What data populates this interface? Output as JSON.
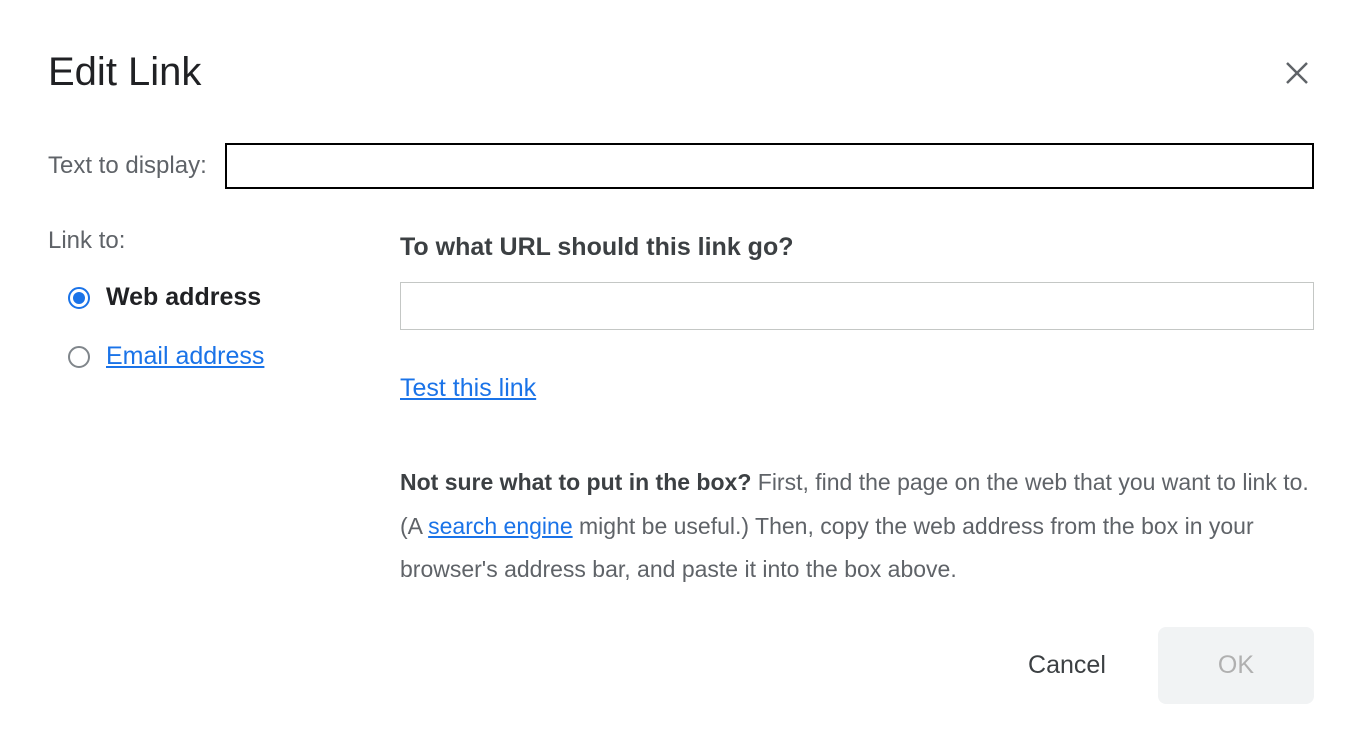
{
  "dialog": {
    "title": "Edit Link",
    "text_to_display_label": "Text to display:",
    "text_to_display_value": "",
    "link_to_label": "Link to:",
    "options": {
      "web_address": "Web address",
      "email_address": "Email address"
    },
    "url_section": {
      "question": "To what URL should this link go?",
      "value": "",
      "test_link": "Test this link",
      "help_bold": "Not sure what to put in the box?",
      "help_part1": " First, find the page on the web that you want to link to. (A ",
      "help_link": "search engine",
      "help_part2": " might be useful.) Then, copy the web address from the box in your browser's address bar, and paste it into the box above."
    },
    "footer": {
      "cancel": "Cancel",
      "ok": "OK"
    }
  }
}
